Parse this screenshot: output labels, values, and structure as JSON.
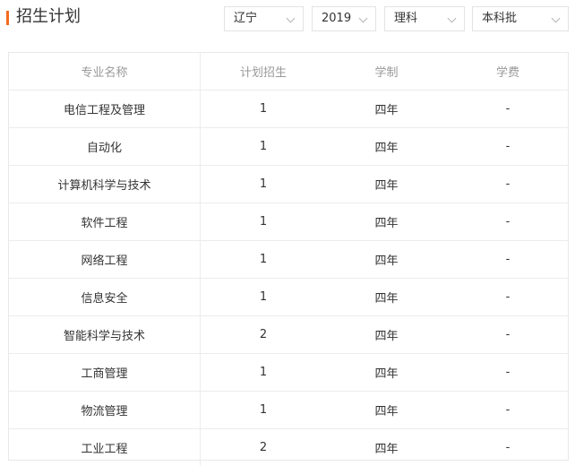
{
  "header": {
    "title": "招生计划",
    "filters": {
      "province": "辽宁",
      "year": "2019",
      "subject": "理科",
      "batch": "本科批"
    }
  },
  "colors": {
    "accent": "#f26b1d"
  },
  "table": {
    "columns": [
      "专业名称",
      "计划招生",
      "学制",
      "学费"
    ],
    "rows": [
      {
        "major": "电信工程及管理",
        "plan": "1",
        "duration": "四年",
        "fee": "-"
      },
      {
        "major": "自动化",
        "plan": "1",
        "duration": "四年",
        "fee": "-"
      },
      {
        "major": "计算机科学与技术",
        "plan": "1",
        "duration": "四年",
        "fee": "-"
      },
      {
        "major": "软件工程",
        "plan": "1",
        "duration": "四年",
        "fee": "-"
      },
      {
        "major": "网络工程",
        "plan": "1",
        "duration": "四年",
        "fee": "-"
      },
      {
        "major": "信息安全",
        "plan": "1",
        "duration": "四年",
        "fee": "-"
      },
      {
        "major": "智能科学与技术",
        "plan": "2",
        "duration": "四年",
        "fee": "-"
      },
      {
        "major": "工商管理",
        "plan": "1",
        "duration": "四年",
        "fee": "-"
      },
      {
        "major": "物流管理",
        "plan": "1",
        "duration": "四年",
        "fee": "-"
      },
      {
        "major": "工业工程",
        "plan": "2",
        "duration": "四年",
        "fee": "-"
      }
    ]
  }
}
